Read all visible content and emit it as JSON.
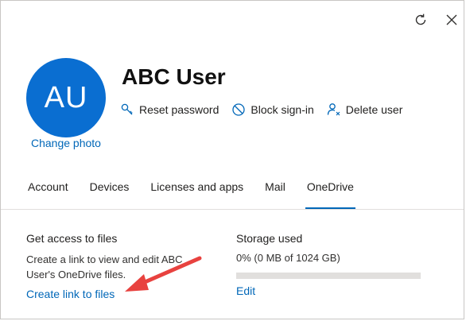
{
  "header": {
    "refresh_icon": "refresh-icon",
    "close_icon": "close-icon"
  },
  "profile": {
    "initials": "AU",
    "avatar_color": "#0a6ed1",
    "change_photo": "Change photo",
    "name": "ABC User"
  },
  "actions": [
    {
      "label": "Reset password",
      "icon": "key-icon"
    },
    {
      "label": "Block sign-in",
      "icon": "block-icon"
    },
    {
      "label": "Delete user",
      "icon": "delete-user-icon"
    }
  ],
  "tabs": [
    {
      "label": "Account"
    },
    {
      "label": "Devices"
    },
    {
      "label": "Licenses and apps"
    },
    {
      "label": "Mail"
    },
    {
      "label": "OneDrive",
      "active": true
    }
  ],
  "files": {
    "heading": "Get access to files",
    "description": "Create a link to view and edit ABC User's OneDrive files.",
    "link": "Create link to files"
  },
  "storage": {
    "heading": "Storage used",
    "value": "0% (0 MB of 1024 GB)",
    "percent_used": 0,
    "edit": "Edit"
  },
  "colors": {
    "link": "#0067b8",
    "annotation_arrow": "#e8423f"
  }
}
